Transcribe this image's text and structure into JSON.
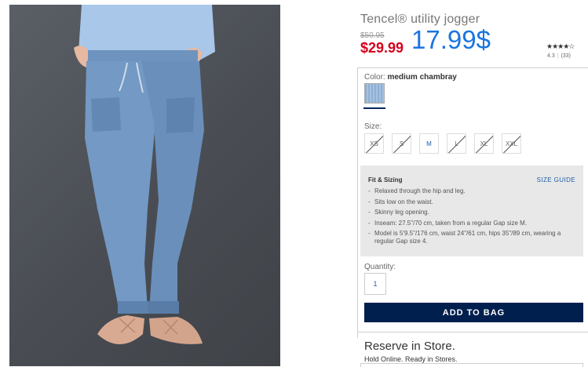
{
  "product": {
    "title": "Tencel® utility jogger",
    "old_price": "$50.95",
    "sale_price": "$29.99",
    "big_price": "17.99$",
    "stars": "★★★★☆",
    "rating_value": "4.3",
    "rating_count": "(33)"
  },
  "color": {
    "label": "Color:",
    "name": "medium chambray"
  },
  "size": {
    "label": "Size:",
    "options": [
      {
        "label": "XS",
        "available": false
      },
      {
        "label": "S",
        "available": false
      },
      {
        "label": "M",
        "available": true
      },
      {
        "label": "L",
        "available": false
      },
      {
        "label": "XL",
        "available": false
      },
      {
        "label": "XXL",
        "available": false
      }
    ]
  },
  "fit": {
    "title": "Fit & Sizing",
    "size_guide": "SIZE GUIDE",
    "bullets": [
      "Relaxed through the hip and leg.",
      "Sits low on the waist.",
      "Skinny leg opening.",
      "Inseam: 27.5\"/70 cm, taken from a regular Gap size M.",
      "Model is 5'9.5\"/176 cm, waist 24\"/61 cm, hips 35\"/89 cm, wearing a regular Gap size 4."
    ]
  },
  "quantity": {
    "label": "Quantity:",
    "value": "1"
  },
  "cta": {
    "add_to_bag": "ADD TO BAG"
  },
  "reserve": {
    "title": "Reserve in Store.",
    "subtitle": "Hold Online. Ready in Stores."
  },
  "colors": {
    "sale_red": "#d6001c",
    "price_blue": "#1a75e0",
    "button_navy": "#001f4e",
    "link_blue": "#1f5fa8"
  }
}
